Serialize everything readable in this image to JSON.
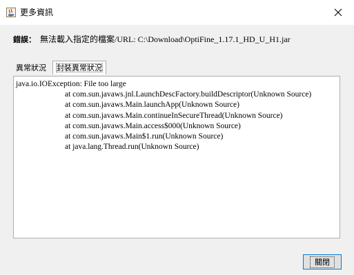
{
  "window": {
    "title": "更多資訊",
    "close_glyph": "✕"
  },
  "error": {
    "label": "錯誤：",
    "message": "無法載入指定的檔案/URL: C:\\Download\\OptiFine_1.17.1_HD_U_H1.jar"
  },
  "tabs": [
    {
      "label": "異常狀況",
      "active": false
    },
    {
      "label": "封裝異常狀況",
      "active": true
    }
  ],
  "trace": {
    "exception": "java.io.IOException: File too large",
    "frames": [
      "at com.sun.javaws.jnl.LaunchDescFactory.buildDescriptor(Unknown Source)",
      "at com.sun.javaws.Main.launchApp(Unknown Source)",
      "at com.sun.javaws.Main.continueInSecureThread(Unknown Source)",
      "at com.sun.javaws.Main.access$000(Unknown Source)",
      "at com.sun.javaws.Main$1.run(Unknown Source)",
      "at java.lang.Thread.run(Unknown Source)"
    ]
  },
  "footer": {
    "close_label": "關閉"
  }
}
